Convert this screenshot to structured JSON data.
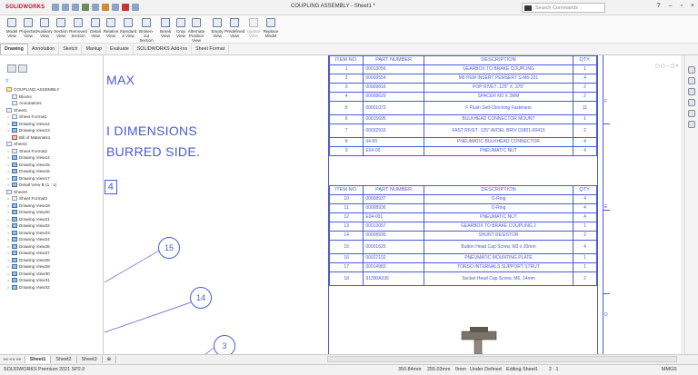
{
  "window": {
    "title": "COUPLING ASSEMBLY - Sheet1 *",
    "app_logo": "SOLIDWORKS",
    "search_placeholder": "Search Commands"
  },
  "ribbon": [
    {
      "label": "Model\nView"
    },
    {
      "label": "Projected\nView"
    },
    {
      "label": "Auxiliary\nView"
    },
    {
      "label": "Section\nView"
    },
    {
      "label": "Removed\nSection"
    },
    {
      "label": "Detail\nView"
    },
    {
      "label": "Relative\nView"
    },
    {
      "label": "Standard\n3 View"
    },
    {
      "label": "Broken-out\nSection"
    },
    {
      "label": "Break\nView"
    },
    {
      "label": "Crop\nView"
    },
    {
      "label": "Alternate\nPosition View"
    },
    {
      "label": "Empty\nView"
    },
    {
      "label": "Predefined\nView"
    },
    {
      "label": "Update\nView",
      "disabled": true
    },
    {
      "label": "Replace\nModel"
    }
  ],
  "command_tabs": [
    "Drawing",
    "Annotation",
    "Sketch",
    "Markup",
    "Evaluate",
    "SOLIDWORKS Add-Ins",
    "Sheet Format"
  ],
  "tree": [
    {
      "label": "COUPLING ASSEMBLY",
      "lvl": 0,
      "icon": "assembly"
    },
    {
      "label": "Blocks",
      "lvl": 1,
      "icon": "folder"
    },
    {
      "label": "Annotations",
      "lvl": 1,
      "icon": "folder"
    },
    {
      "label": "Sheet1",
      "lvl": 0,
      "icon": "sheet",
      "tw": "-"
    },
    {
      "label": "Sheet Format1",
      "lvl": 1,
      "icon": "sheet",
      "tw": ">"
    },
    {
      "label": "Drawing View12",
      "lvl": 1,
      "icon": "view",
      "tw": ">"
    },
    {
      "label": "Drawing View13",
      "lvl": 1,
      "icon": "view",
      "tw": ">"
    },
    {
      "label": "Bill of Materials1",
      "lvl": 1,
      "icon": "table"
    },
    {
      "label": "Sheet2",
      "lvl": 0,
      "icon": "sheet",
      "tw": "-"
    },
    {
      "label": "Sheet Format2",
      "lvl": 1,
      "icon": "sheet",
      "tw": ">"
    },
    {
      "label": "Drawing View14",
      "lvl": 1,
      "icon": "view",
      "tw": ">"
    },
    {
      "label": "Drawing View15",
      "lvl": 1,
      "icon": "view",
      "tw": ">"
    },
    {
      "label": "Drawing View16",
      "lvl": 1,
      "icon": "view",
      "tw": ">"
    },
    {
      "label": "Drawing View17",
      "lvl": 1,
      "icon": "view",
      "tw": ">"
    },
    {
      "label": "Detail View B (1 : 1)",
      "lvl": 1,
      "icon": "view",
      "tw": ">"
    },
    {
      "label": "Sheet3",
      "lvl": 0,
      "icon": "sheet",
      "tw": "-"
    },
    {
      "label": "Sheet Format3",
      "lvl": 1,
      "icon": "sheet",
      "tw": ">"
    },
    {
      "label": "Drawing View19",
      "lvl": 1,
      "icon": "view",
      "tw": ">"
    },
    {
      "label": "Drawing View20",
      "lvl": 1,
      "icon": "view",
      "tw": ">"
    },
    {
      "label": "Drawing View21",
      "lvl": 1,
      "icon": "view",
      "tw": ">"
    },
    {
      "label": "Drawing View22",
      "lvl": 1,
      "icon": "view",
      "tw": ">"
    },
    {
      "label": "Drawing View23",
      "lvl": 1,
      "icon": "view",
      "tw": ">"
    },
    {
      "label": "Drawing View24",
      "lvl": 1,
      "icon": "view",
      "tw": ">"
    },
    {
      "label": "Drawing View26",
      "lvl": 1,
      "icon": "view",
      "tw": ">"
    },
    {
      "label": "Drawing View27",
      "lvl": 1,
      "icon": "view",
      "tw": ">"
    },
    {
      "label": "Drawing View28",
      "lvl": 1,
      "icon": "view",
      "tw": ">"
    },
    {
      "label": "Drawing View29",
      "lvl": 1,
      "icon": "view",
      "tw": ">"
    },
    {
      "label": "Drawing View30",
      "lvl": 1,
      "icon": "view",
      "tw": ">"
    },
    {
      "label": "Drawing View31",
      "lvl": 1,
      "icon": "view",
      "tw": ">"
    },
    {
      "label": "Drawing View32",
      "lvl": 1,
      "icon": "view",
      "tw": ">"
    }
  ],
  "canvas_notes": [
    "MAX",
    "I DIMENSIONS",
    "BURRED SIDE.",
    "4"
  ],
  "balloons": [
    "15",
    "14",
    "3"
  ],
  "bom_headers": [
    "ITEM NO.",
    "PART NUMBER",
    "DESCRIPTION",
    "QTY."
  ],
  "bom1": [
    [
      "1",
      "00013056",
      "GEARBOX TO BRAKE COUPLING",
      "1"
    ],
    [
      "2",
      "00009554",
      "M6 PEM INSERT PEMSERT S-M6-221",
      "4"
    ],
    [
      "3",
      "00009816",
      "POP RIVET .125\" X .375\"",
      "2"
    ],
    [
      "4",
      "00008620",
      "SPACER M3 X 2MM",
      "2"
    ],
    [
      "5",
      "00001072",
      "F Flush Self-Clinching Fasteners",
      "11"
    ],
    [
      "6",
      "00015695",
      "BULKHEAD CONNECTOR MOUNT",
      "1"
    ],
    [
      "7",
      "00032916",
      "FAST RIVET .125\" AVDEL BRIV 01801-00410",
      "2"
    ],
    [
      "8",
      "04-00",
      "PNEUMATIC BULKHEAD CONNECTOR",
      "4"
    ],
    [
      "9",
      "E04-00",
      "PNEUMATIC NUT",
      "4"
    ]
  ],
  "bom2": [
    [
      "10",
      "00008937",
      "O-Ring",
      "4"
    ],
    [
      "11",
      "00008936",
      "O-Ring",
      "4"
    ],
    [
      "12",
      "E04-001",
      "PNEUMATIC NUT",
      "4"
    ],
    [
      "13",
      "00013057",
      "GEARBOX TO BRAKE COUPLING 2",
      "1"
    ],
    [
      "14",
      "00008935",
      "SHUNT RESISTOR",
      "2"
    ],
    [
      "15",
      "00001625",
      "Button Head Cap Screw, M3 x 20mm",
      "4"
    ],
    [
      "16",
      "00022102",
      "PNEUMATIC MOUNTING PLATE",
      "1"
    ],
    [
      "17",
      "00014983",
      "TORSO INTERNALS SUPPORT STRUT",
      "1"
    ],
    [
      "18",
      "91290A336",
      "Socket Head Cap Screw, M6, 14mm",
      "2"
    ]
  ],
  "frame_letters": [
    "F",
    "E",
    "D"
  ],
  "sheet_tabs": [
    "Sheet1",
    "Sheet2",
    "Sheet3"
  ],
  "status": {
    "left": "SOLIDWORKS Premium 2021 SP2.0",
    "x": "350.84mm",
    "y": "255.03mm",
    "z": "0mm",
    "defined": "Under Defined",
    "editing": "Editing Sheet1",
    "scale": "2 : 1",
    "units": "MMGS"
  },
  "colors": {
    "drawing_blue": "#4a5bd4"
  }
}
